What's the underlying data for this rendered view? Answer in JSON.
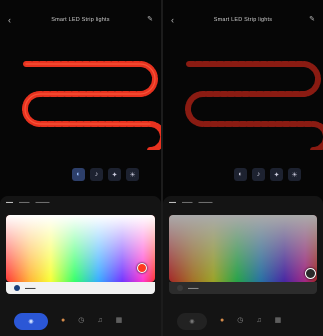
{
  "app": {
    "title": "Smart LED Strip lights"
  },
  "icons": {
    "back": "back-arrow-icon",
    "edit": "edit-icon",
    "tools": [
      "color-palette-icon",
      "music-icon",
      "sparkle-icon",
      "sun-icon"
    ],
    "nav": [
      "color-wheel-icon",
      "scene-icon",
      "timer-icon",
      "music-note-icon",
      "grid-icon"
    ]
  },
  "colors": {
    "strip_on": "#e8321f",
    "strip_dim": "#8a1b12",
    "accent": "#2b57d6",
    "selected_color": "#ff3a1f"
  }
}
